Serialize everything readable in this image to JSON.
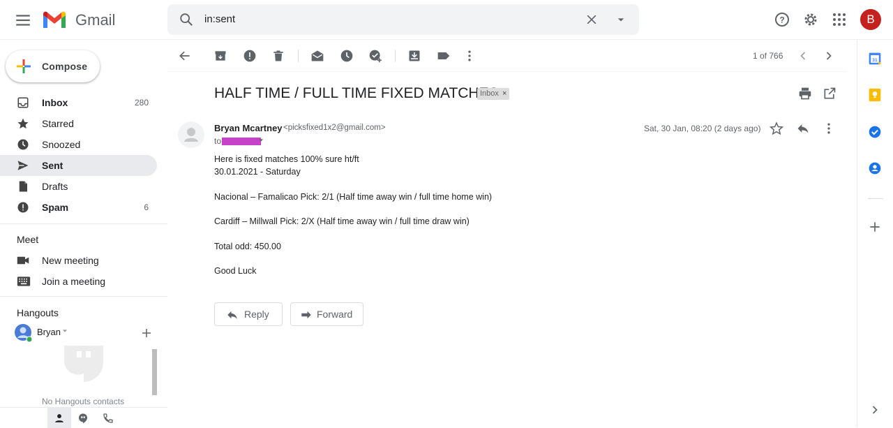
{
  "app": {
    "name": "Gmail"
  },
  "search": {
    "query": "in:sent"
  },
  "user": {
    "avatar_letter": "B",
    "avatar_color": "#c5221f"
  },
  "sidebar": {
    "compose_label": "Compose",
    "items": [
      {
        "label": "Inbox",
        "count": "280",
        "bold": true,
        "icon": "inbox-icon"
      },
      {
        "label": "Starred",
        "count": "",
        "bold": false,
        "icon": "star-icon"
      },
      {
        "label": "Snoozed",
        "count": "",
        "bold": false,
        "icon": "clock-icon"
      },
      {
        "label": "Sent",
        "count": "",
        "bold": true,
        "icon": "send-icon",
        "active": true
      },
      {
        "label": "Drafts",
        "count": "",
        "bold": false,
        "icon": "draft-icon"
      },
      {
        "label": "Spam",
        "count": "6",
        "bold": true,
        "icon": "spam-icon"
      }
    ]
  },
  "meet": {
    "title": "Meet",
    "items": [
      {
        "label": "New meeting",
        "icon": "video-icon"
      },
      {
        "label": "Join a meeting",
        "icon": "keyboard-icon"
      }
    ]
  },
  "hangouts": {
    "title": "Hangouts",
    "user_name": "Bryan",
    "empty_text": "No Hangouts contacts"
  },
  "toolbar": {
    "pager": "1 of 766"
  },
  "message": {
    "subject": "HALF TIME / FULL TIME FIXED MATCHES",
    "label": "Inbox",
    "sender_name": "Bryan Mcartney",
    "sender_email": "<picksfixed1x2@gmail.com>",
    "to_prefix": "to",
    "date": "Sat, 30 Jan, 08:20 (2 days ago)",
    "body": [
      "Here is fixed matches 100% sure ht/ft",
      "30.01.2021 - Saturday",
      "Nacional – Famalicao Pick: 2/1 (Half time away win / full time home win)",
      "Cardiff – Millwall Pick: 2/X (Half time away win / full time draw win)",
      "Total odd: 450.00",
      "Good Luck"
    ],
    "reply_label": "Reply",
    "forward_label": "Forward"
  },
  "colors": {
    "accent_active_bg": "#e8eaed",
    "redaction": "#c642c8",
    "icon_gray": "#5f6368"
  }
}
